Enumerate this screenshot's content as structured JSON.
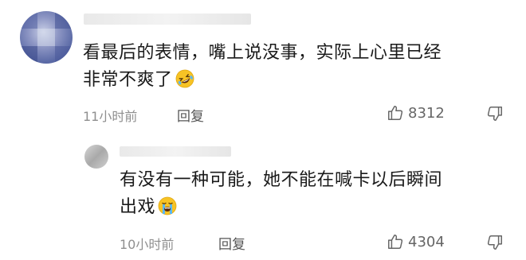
{
  "comments": [
    {
      "text_line1": "看最后的表情，嘴上说没事，实际上心里已经",
      "text_line2": "非常不爽了",
      "emoji_icon": "rolling-on-floor-laughing-emoji",
      "time": "11小时前",
      "reply_label": "回复",
      "like_count": "8312"
    },
    {
      "text_line1": "有没有一种可能，她不能在喊卡以后瞬间",
      "text_line2": "出戏",
      "emoji_icon": "loudly-crying-emoji",
      "time": "10小时前",
      "reply_label": "回复",
      "like_count": "4304"
    }
  ],
  "icons": {
    "like": "thumbs-up-icon",
    "dislike": "thumbs-down-icon"
  },
  "colors": {
    "text": "#1a1a1a",
    "meta": "#8f8f8f",
    "emoji_yellow": "#f7c325"
  }
}
